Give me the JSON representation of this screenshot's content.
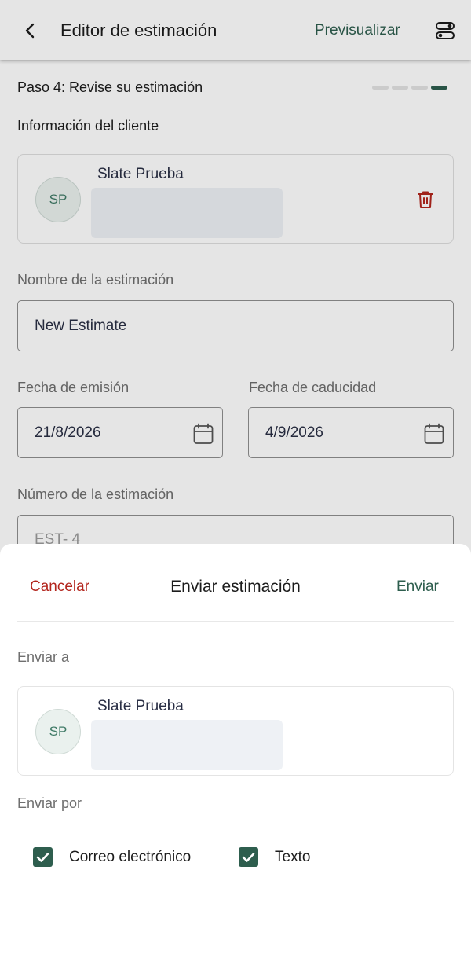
{
  "header": {
    "title": "Editor de estimación",
    "preview_label": "Previsualizar"
  },
  "step": {
    "label": "Paso 4: Revise su estimación",
    "total": 4,
    "current": 4
  },
  "client_section": {
    "title": "Información del cliente",
    "avatar_initials": "SP",
    "name": "Slate Prueba"
  },
  "estimate": {
    "name_label": "Nombre de la estimación",
    "name_value": "New Estimate",
    "issue_date_label": "Fecha de emisión",
    "issue_date_value": "21/8/2026",
    "due_date_label": "Fecha de caducidad",
    "due_date_value": "4/9/2026",
    "number_label": "Número de la estimación",
    "number_value": "EST-   4"
  },
  "sheet": {
    "cancel_label": "Cancelar",
    "title": "Enviar estimación",
    "send_label": "Enviar",
    "send_to_label": "Enviar a",
    "recipient_initials": "SP",
    "recipient_name": "Slate Prueba",
    "send_via_label": "Enviar por",
    "options": [
      {
        "label": "Correo electrónico",
        "checked": true
      },
      {
        "label": "Texto",
        "checked": true
      }
    ]
  },
  "colors": {
    "brand_green": "#2e5e4e",
    "danger_red": "#b3261e"
  },
  "icons": [
    "back-arrow-icon",
    "options-toggle-icon",
    "trash-icon",
    "calendar-icon",
    "checkmark-icon"
  ]
}
